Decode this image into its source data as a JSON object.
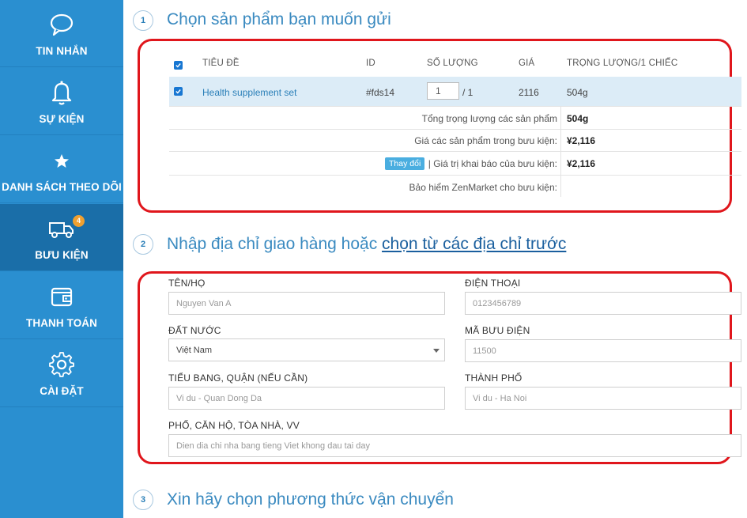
{
  "sidebar": {
    "items": [
      {
        "label": "TIN NHẮN",
        "icon": "chat-bubble-icon"
      },
      {
        "label": "SỰ KIỆN",
        "icon": "bell-icon"
      },
      {
        "label": "DANH SÁCH THEO DÕI",
        "icon": "star-icon"
      },
      {
        "label": "BƯU KIỆN",
        "icon": "truck-icon",
        "badge": "4",
        "active": true
      },
      {
        "label": "THANH TOÁN",
        "icon": "wallet-icon"
      },
      {
        "label": "CÀI ĐẶT",
        "icon": "gear-icon"
      }
    ]
  },
  "step1": {
    "number": "1",
    "title": "Chọn sản phẩm bạn muốn gửi",
    "headers": {
      "title": "TIÊU ĐỀ",
      "id": "ID",
      "qty": "SỐ LƯỢNG",
      "price": "GIÁ",
      "weight": "TRỌNG LƯỢNG/1 CHIẾC"
    },
    "product": {
      "title": "Health supplement set",
      "id": "#fds14",
      "qty": "1",
      "qty_total": "/ 1",
      "price": "2116",
      "weight": "504g"
    },
    "summary": {
      "total_weight_label": "Tổng trọng lượng các sản phẩm",
      "total_weight": "504g",
      "goods_value_label": "Giá các sản phẩm trong bưu kiện:",
      "goods_value": "¥2,116",
      "change_button": "Thay đổi",
      "declared_label": "| Giá trị khai báo của bưu kiện:",
      "declared_value": "¥2,116",
      "insurance_label": "Bảo hiểm ZenMarket cho bưu kiện:"
    }
  },
  "step2": {
    "number": "2",
    "title_prefix": "Nhập địa chỉ giao hàng hoặc ",
    "title_link": "chọn từ các địa chỉ trước",
    "fields": {
      "name_label": "TÊN/HỌ",
      "name_placeholder": "Nguyen Van A",
      "phone_label": "ĐIỆN THOẠI",
      "phone_placeholder": "0123456789",
      "country_label": "ĐẤT NƯỚC",
      "country_value": "Việt Nam",
      "postal_label": "MÃ BƯU ĐIỆN",
      "postal_placeholder": "11500",
      "state_label": "TIỂU BANG, QUẬN (NẾU CẦN)",
      "state_placeholder": "Vi du - Quan Dong Da",
      "city_label": "THÀNH PHỐ",
      "city_placeholder": "Vi du - Ha Noi",
      "street_label": "PHỐ, CĂN HỘ, TÒA NHÀ, VV",
      "street_placeholder": "Dien dia chi nha bang tieng Viet khong dau tai day"
    }
  },
  "step3": {
    "number": "3",
    "title": "Xin hãy chọn phương thức vận chuyển"
  },
  "colors": {
    "sidebar": "#2a8fd0",
    "sidebar_active": "#1a6ea8",
    "highlight": "#e0161c",
    "accent": "#3a8ac0",
    "badge": "#f0a030"
  }
}
